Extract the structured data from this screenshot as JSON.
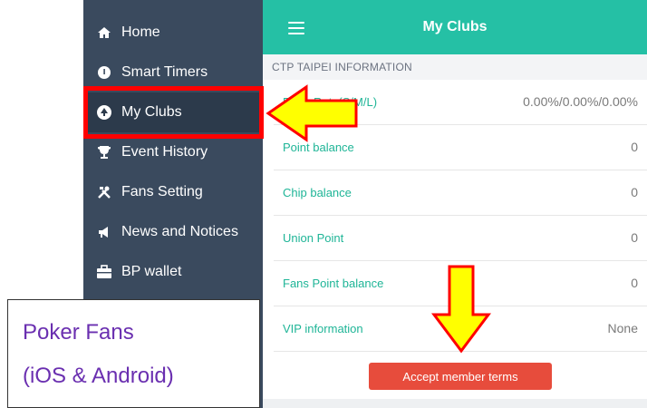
{
  "sidebar": {
    "items": [
      {
        "label": "Home",
        "icon": "home-icon"
      },
      {
        "label": "Smart Timers",
        "icon": "timer-icon"
      },
      {
        "label": "My Clubs",
        "icon": "club-icon"
      },
      {
        "label": "Event History",
        "icon": "trophy-icon"
      },
      {
        "label": "Fans Setting",
        "icon": "tools-icon"
      },
      {
        "label": "News and Notices",
        "icon": "megaphone-icon"
      },
      {
        "label": "BP wallet",
        "icon": "briefcase-icon"
      }
    ]
  },
  "header": {
    "title": "My Clubs"
  },
  "section": {
    "title": "CTP TAIPEI INFORMATION"
  },
  "rows": [
    {
      "label": "Rake Rate(S/M/L)",
      "value": "0.00%/0.00%/0.00%"
    },
    {
      "label": "Point balance",
      "value": "0"
    },
    {
      "label": "Chip balance",
      "value": "0"
    },
    {
      "label": "Union Point",
      "value": "0"
    },
    {
      "label": "Fans Point balance",
      "value": "0"
    },
    {
      "label": "VIP information",
      "value": "None"
    }
  ],
  "accept_button": "Accept member terms",
  "callout": {
    "line1": "Poker Fans",
    "line2": "(iOS & Android)"
  },
  "colors": {
    "accent": "#25c0a5",
    "sidebar": "#3a4a5e",
    "button": "#e74c3c",
    "highlight": "#ff0000",
    "arrow": "#ffff00"
  }
}
